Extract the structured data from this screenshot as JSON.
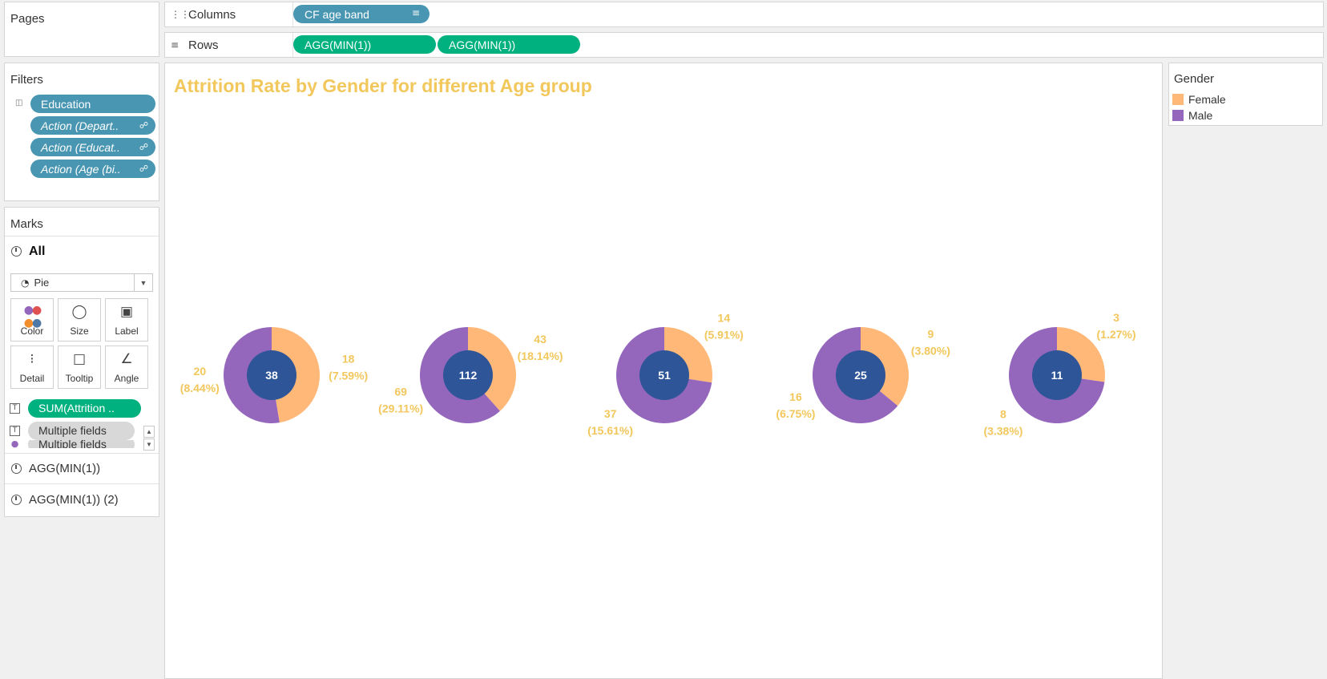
{
  "pages": {
    "title": "Pages"
  },
  "shelves": {
    "columns": {
      "label": "Columns",
      "icon": "columns-icon",
      "pills": [
        "CF age band"
      ]
    },
    "rows": {
      "label": "Rows",
      "icon": "rows-icon",
      "pills": [
        "AGG(MIN(1))",
        "AGG(MIN(1))"
      ]
    }
  },
  "filters": {
    "title": "Filters",
    "items": [
      "Education",
      "Action (Depart..",
      "Action (Educat..",
      "Action (Age (bi.."
    ]
  },
  "marks": {
    "title": "Marks",
    "all_label": "All",
    "mark_type": "Pie",
    "buttons": [
      "Color",
      "Size",
      "Label",
      "Detail",
      "Tooltip",
      "Angle"
    ],
    "fields": [
      "SUM(Attrition ..",
      "Multiple fields",
      "Multiple fields"
    ],
    "cards": [
      "AGG(MIN(1))",
      "AGG(MIN(1)) (2)"
    ]
  },
  "legend": {
    "title": "Gender",
    "items": [
      {
        "label": "Female",
        "color": "#ffb877"
      },
      {
        "label": "Male",
        "color": "#9467bd"
      }
    ]
  },
  "colors": {
    "female": "#ffb877",
    "male": "#9467bd",
    "center": "#2e5597",
    "label": "#f2c75c",
    "title": "#f2c75c"
  },
  "chart_data": {
    "type": "pie",
    "title": "Attrition Rate by Gender for different Age group",
    "groups": [
      {
        "total": "38",
        "female": 18,
        "female_label": "18",
        "female_pct": "(7.59%)",
        "male": 20,
        "male_label": "20",
        "male_pct": "(8.44%)"
      },
      {
        "total": "112",
        "female": 43,
        "female_label": "43",
        "female_pct": "(18.14%)",
        "male": 69,
        "male_label": "69",
        "male_pct": "(29.11%)"
      },
      {
        "total": "51",
        "female": 14,
        "female_label": "14",
        "female_pct": "(5.91%)",
        "male": 37,
        "male_label": "37",
        "male_pct": "(15.61%)"
      },
      {
        "total": "25",
        "female": 9,
        "female_label": "9",
        "female_pct": "(3.80%)",
        "male": 16,
        "male_label": "16",
        "male_pct": "(6.75%)"
      },
      {
        "total": "11",
        "female": 3,
        "female_label": "3",
        "female_pct": "(1.27%)",
        "male": 8,
        "male_label": "8",
        "male_pct": "(3.38%)"
      }
    ]
  }
}
